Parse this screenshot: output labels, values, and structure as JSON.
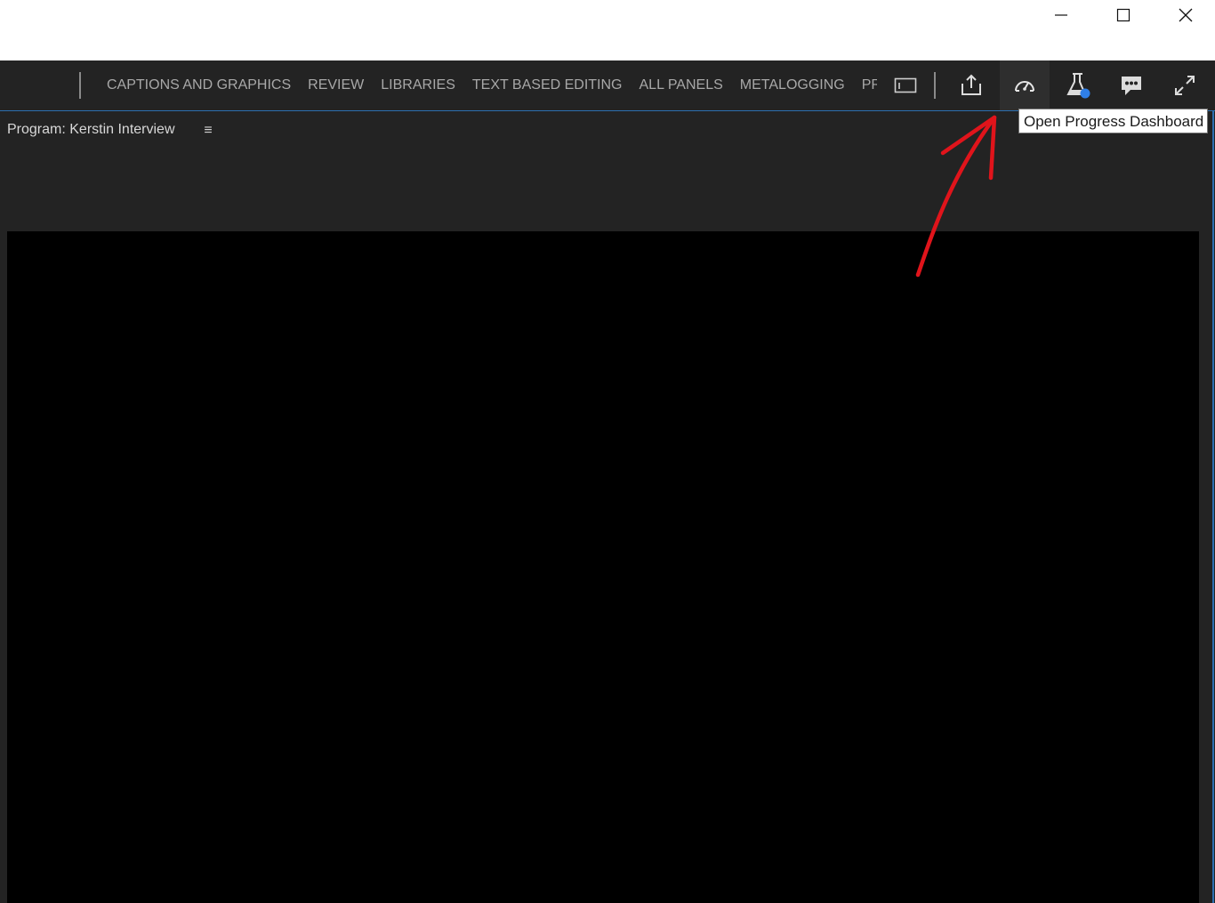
{
  "window_controls": {
    "minimize_icon": "minimize-icon",
    "maximize_icon": "maximize-icon",
    "close_icon": "close-icon"
  },
  "toolbar": {
    "workspaces": [
      "CAPTIONS AND GRAPHICS",
      "REVIEW",
      "LIBRARIES",
      "TEXT BASED EDITING",
      "ALL PANELS",
      "METALOGGING",
      "PRODUCTION"
    ],
    "icons": {
      "workspace_menu": "workspace-menu-icon",
      "share": "share-icon",
      "progress": "speedometer-icon",
      "beta": "flask-icon",
      "feedback": "chat-bubble-icon",
      "fullscreen": "expand-icon"
    },
    "beta_badge_color": "#2f7fe8"
  },
  "tooltip": {
    "text": "Open Progress Dashboard"
  },
  "panel": {
    "title": "Program: Kerstin Interview",
    "menu_icon": "≡"
  },
  "colors": {
    "annotation_arrow": "#e0141b",
    "accent": "#2c6fb0"
  }
}
